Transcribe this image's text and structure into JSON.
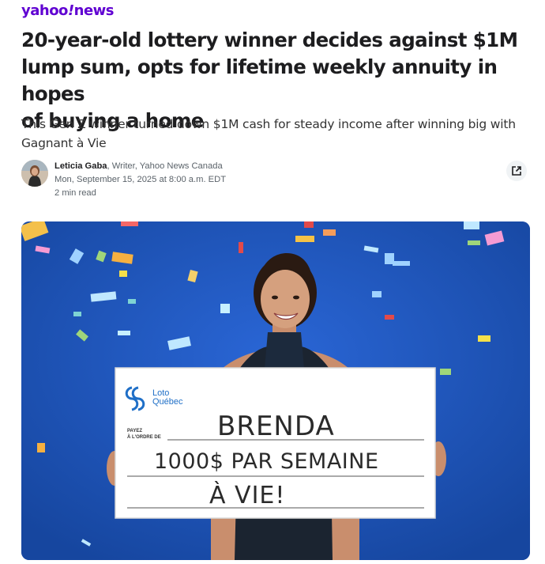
{
  "header": {
    "brand_main": "yahoo",
    "brand_bang": "!",
    "brand_section": "news"
  },
  "article": {
    "headline_lines": [
      "20-year-old lottery winner decides against $1M",
      "lump sum, opts for lifetime weekly annuity in hopes",
      "of buying a home"
    ],
    "subheadline_lines": [
      "This Gen Z winner turned down $1M cash for steady income after winning big with",
      "Gagnant à Vie"
    ],
    "author_name": "Leticia Gaba",
    "author_role": ", Writer, Yahoo News Canada",
    "date": "Mon, September 15, 2025 at 8:00 a.m. EDT",
    "read_time": "2 min read"
  },
  "hero_image": {
    "check_logo_line1": "Loto",
    "check_logo_line2": "Québec",
    "payee_label_line1": "PAYEZ",
    "payee_label_line2": "À L'ORDRE DE",
    "handwriting_line1": "BRENDA",
    "handwriting_line2": "1000$ PAR SEMAINE",
    "handwriting_line3": "À VIE!"
  },
  "icons": {
    "share": "external-share-icon"
  },
  "colors": {
    "brand_purple": "#6001d2",
    "hero_background": "#1f56c4"
  }
}
